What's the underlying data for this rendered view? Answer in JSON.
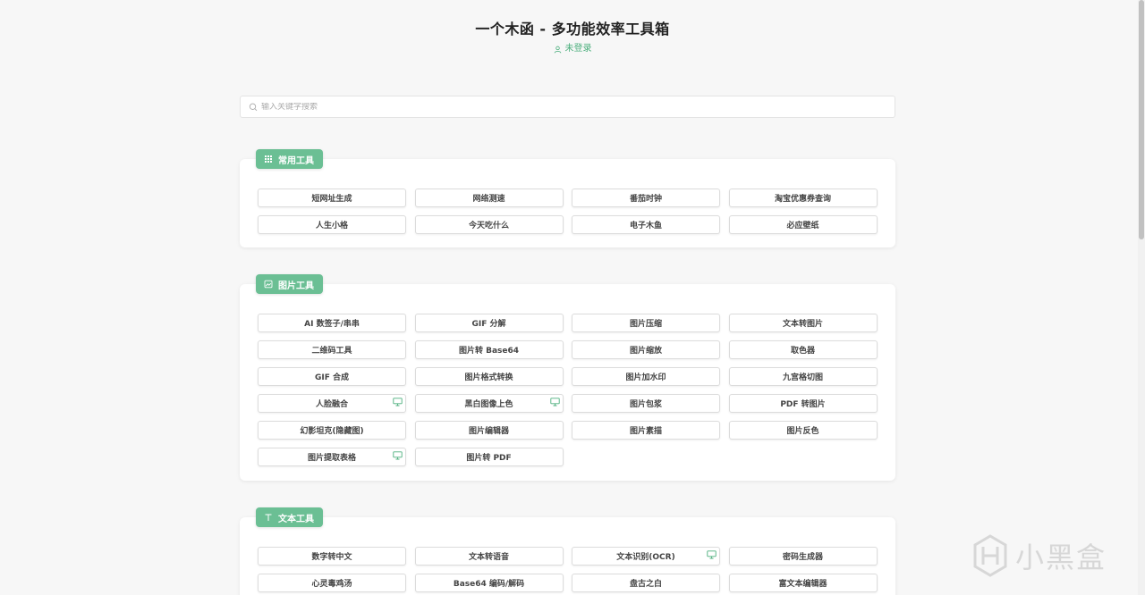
{
  "header": {
    "title": "一个木函 - 多功能效率工具箱",
    "login_status": "未登录"
  },
  "search": {
    "placeholder": "输入关键字搜索",
    "value": ""
  },
  "accent_color": "#6bbf94",
  "sections": {
    "common": {
      "title": "常用工具",
      "items": [
        "短网址生成",
        "网络测速",
        "番茄时钟",
        "淘宝优惠券查询",
        "人生小格",
        "今天吃什么",
        "电子木鱼",
        "必应壁纸"
      ]
    },
    "image": {
      "title": "图片工具",
      "items": [
        "AI 数签子/串串",
        "GIF 分解",
        "图片压缩",
        "文本转图片",
        "二维码工具",
        "图片转 Base64",
        "图片缩放",
        "取色器",
        "GIF 合成",
        "图片格式转换",
        "图片加水印",
        "九宫格切图",
        "人脸融合",
        "黑白图像上色",
        "图片包浆",
        "PDF 转图片",
        "幻影坦克(隐藏图)",
        "图片编辑器",
        "图片素描",
        "图片反色",
        "图片提取表格",
        "图片转 PDF"
      ]
    },
    "text": {
      "title": "文本工具",
      "items": [
        "数字转中文",
        "文本转语音",
        "文本识别(OCR)",
        "密码生成器",
        "心灵毒鸡汤",
        "Base64 编码/解码",
        "盘古之白",
        "富文本编辑器"
      ]
    }
  },
  "watermark": {
    "text": "小黑盒"
  }
}
